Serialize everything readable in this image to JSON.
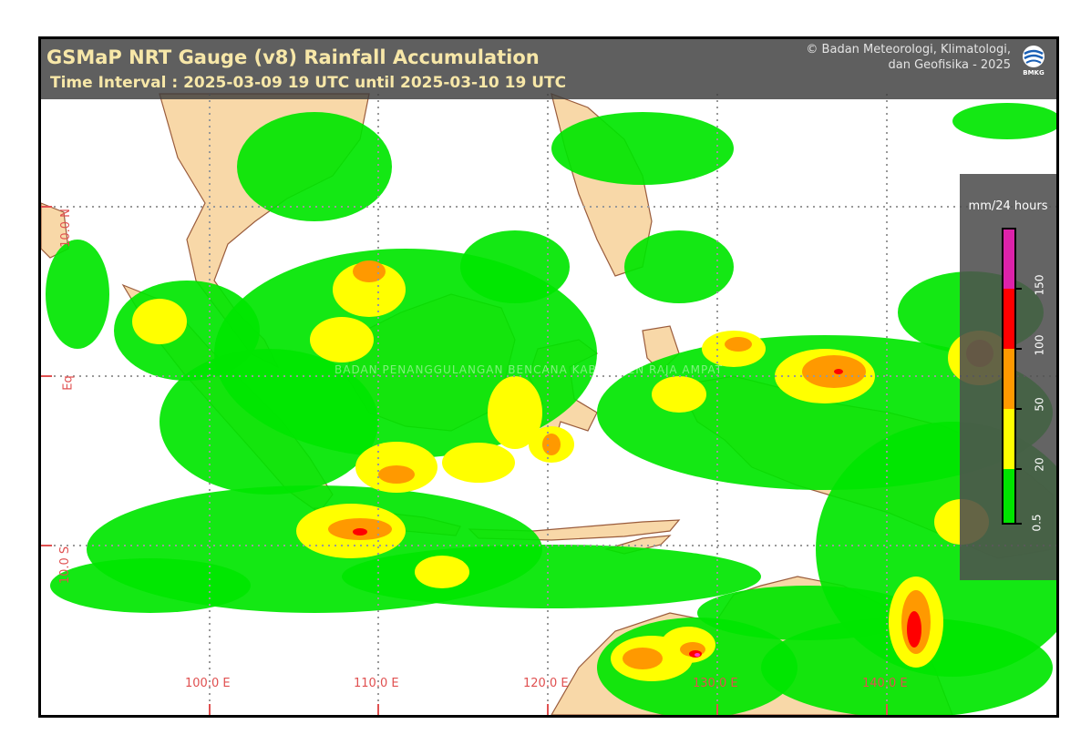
{
  "map": {
    "title": "GSMaP NRT Gauge (v8) Rainfall Accumulation",
    "subtitle": "Time Interval : 2025-03-09 19 UTC until 2025-03-10 19 UTC",
    "credit_line1": "© Badan Meteorologi, Klimatologi,",
    "credit_line2": "dan Geofisika -  2025",
    "logo_text": "BMKG",
    "watermark": "BADAN PENANGGULANGAN BENCANA KABUPATEN RAJA AMPAT",
    "longitude_labels": [
      "100.0 E",
      "110.0 E",
      "120.0 E",
      "130.0 E",
      "140.0 E"
    ],
    "latitude_labels": [
      "10.0 N",
      "Eq",
      "10.0 S"
    ],
    "colors": {
      "land": "#f8d8a8",
      "coast": "#9a5c3c",
      "grid": "#999999",
      "rain_light": "#00e600",
      "rain_moderate": "#ffff00",
      "rain_heavy": "#ff9900",
      "rain_very_heavy": "#ff0000",
      "rain_extreme": "#ff33cc"
    }
  },
  "legend": {
    "unit": "mm/24 hours",
    "ticks": [
      "0.5",
      "20",
      "50",
      "100",
      "150"
    ],
    "colors": [
      "#00e600",
      "#ffff00",
      "#ff9900",
      "#ff0000",
      "#dd22aa"
    ]
  }
}
